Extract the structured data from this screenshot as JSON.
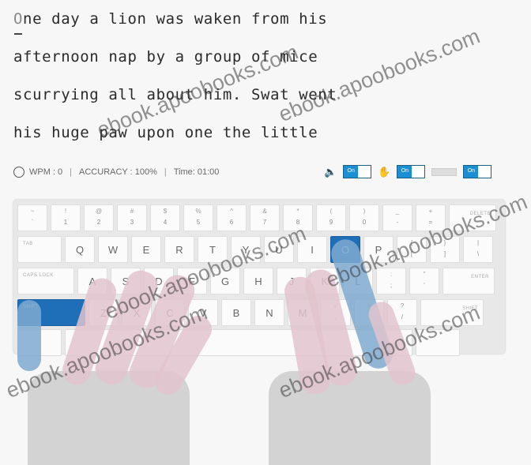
{
  "passage": {
    "lines": [
      "One day a lion was waken from his",
      "afternoon nap by a group of mice",
      "scurrying all about him. Swat went",
      "his huge paw upon one the little"
    ],
    "current_char": "O",
    "line0_rest": "ne day a lion was waken from his"
  },
  "stats": {
    "wpm": "WPM : 0",
    "accuracy": "ACCURACY : 100%",
    "time": "Time: 01:00",
    "separator": "|"
  },
  "controls": {
    "sound_toggle": "On",
    "keyboard_toggle": "On",
    "hands_toggle": "On"
  },
  "keyboard": {
    "active_keys": [
      "O",
      "SHIFT"
    ],
    "row1": [
      {
        "top": "~",
        "bot": "`"
      },
      {
        "top": "!",
        "bot": "1"
      },
      {
        "top": "@",
        "bot": "2"
      },
      {
        "top": "#",
        "bot": "3"
      },
      {
        "top": "$",
        "bot": "4"
      },
      {
        "top": "%",
        "bot": "5"
      },
      {
        "top": "^",
        "bot": "6"
      },
      {
        "top": "&",
        "bot": "7"
      },
      {
        "top": "*",
        "bot": "8"
      },
      {
        "top": "(",
        "bot": "9"
      },
      {
        "top": ")",
        "bot": "0"
      },
      {
        "top": "_",
        "bot": "-"
      },
      {
        "top": "+",
        "bot": "="
      }
    ],
    "backspace": "delete",
    "tab": "tab",
    "row2": [
      "Q",
      "W",
      "E",
      "R",
      "T",
      "Y",
      "U",
      "I",
      "O",
      "P"
    ],
    "row2_sym": [
      {
        "top": "{",
        "bot": "["
      },
      {
        "top": "}",
        "bot": "]"
      },
      {
        "top": "|",
        "bot": "\\"
      }
    ],
    "caps": "caps lock",
    "row3": [
      "A",
      "S",
      "D",
      "F",
      "G",
      "H",
      "J",
      "K",
      "L"
    ],
    "row3_sym": [
      {
        "top": ":",
        "bot": ";"
      },
      {
        "top": "\"",
        "bot": "'"
      }
    ],
    "enter": "enter",
    "shift_left": "shift",
    "row4": [
      "Z",
      "X",
      "C",
      "V",
      "B",
      "N",
      "M"
    ],
    "row4_sym": [
      {
        "top": "<",
        "bot": ","
      },
      {
        "top": ">",
        "bot": "."
      },
      {
        "top": "?",
        "bot": "/"
      }
    ],
    "shift_right": "shift"
  },
  "watermark": "ebook.apoobooks.com",
  "colors": {
    "accent": "#1f6fb8",
    "toggle_on": "#1a8fd6"
  }
}
